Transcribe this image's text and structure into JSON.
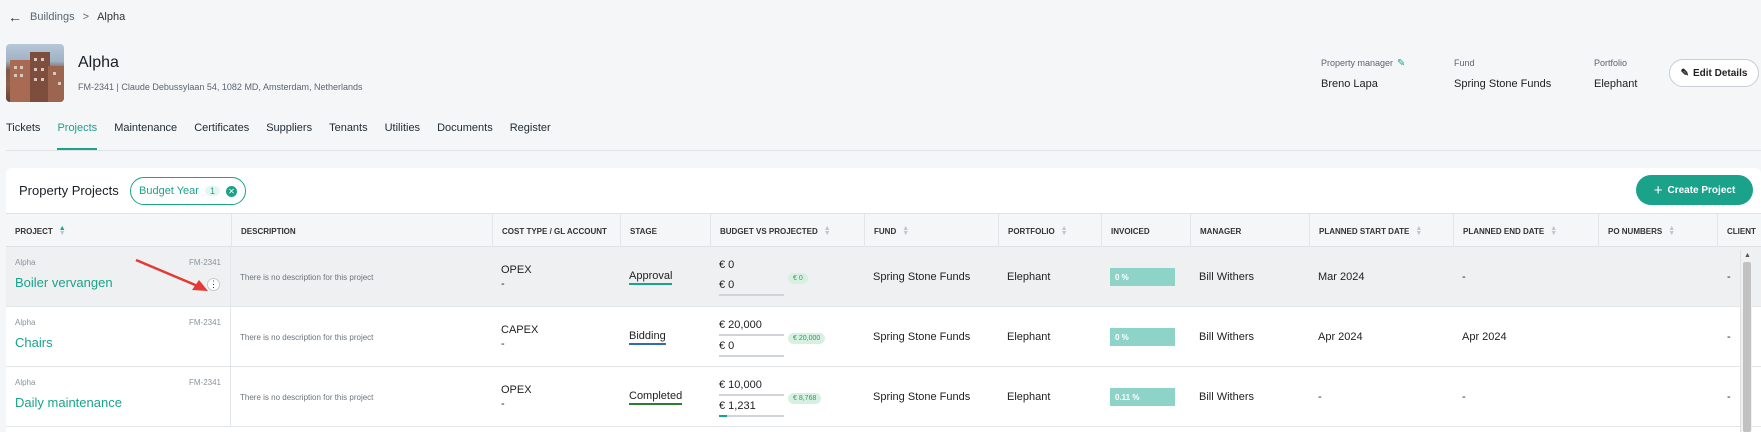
{
  "breadcrumb": {
    "parent": "Buildings",
    "separator": ">",
    "current": "Alpha"
  },
  "property": {
    "name": "Alpha",
    "subtitle": "FM-2341 | Claude Debussylaan 54, 1082 MD, Amsterdam, Netherlands",
    "details": [
      {
        "label": "Property manager",
        "value": "Breno Lapa"
      },
      {
        "label": "Fund",
        "value": "Spring Stone Funds"
      },
      {
        "label": "Portfolio",
        "value": "Elephant"
      }
    ],
    "edit_label": "Edit Details"
  },
  "tabs": [
    {
      "label": "Tickets",
      "active": false
    },
    {
      "label": "Projects",
      "active": true
    },
    {
      "label": "Maintenance",
      "active": false
    },
    {
      "label": "Certificates",
      "active": false
    },
    {
      "label": "Suppliers",
      "active": false
    },
    {
      "label": "Tenants",
      "active": false
    },
    {
      "label": "Utilities",
      "active": false
    },
    {
      "label": "Documents",
      "active": false
    },
    {
      "label": "Register",
      "active": false
    }
  ],
  "panel": {
    "title": "Property Projects",
    "filter_chip": {
      "label": "Budget Year",
      "count": "1"
    },
    "create_label": "Create Project"
  },
  "columns": [
    "Project",
    "Description",
    "Cost Type / GL Account",
    "Stage",
    "Budget vs Projected",
    "Fund",
    "Portfolio",
    "Invoiced",
    "Manager",
    "Planned Start Date",
    "Planned End Date",
    "PO Numbers",
    "Client"
  ],
  "rows": [
    {
      "property": "Alpha",
      "code": "FM-2341",
      "name": "Boiler vervangen",
      "description": "There is no description for this project",
      "cost_type": "OPEX",
      "gl": "-",
      "stage": "Approval",
      "stage_color": "#1aa38a",
      "budget": "€ 0",
      "projected": "€ 0",
      "diff": "€ 0",
      "projected_fraction": 0,
      "fund": "Spring Stone Funds",
      "portfolio": "Elephant",
      "invoiced": "0 %",
      "manager": "Bill Withers",
      "start": "Mar 2024",
      "end": "-",
      "po": "",
      "client": "-"
    },
    {
      "property": "Alpha",
      "code": "FM-2341",
      "name": "Chairs",
      "description": "There is no description for this project",
      "cost_type": "CAPEX",
      "gl": "-",
      "stage": "Bidding",
      "stage_color": "#2f6fb0",
      "budget": "€ 20,000",
      "projected": "€ 0",
      "diff": "€ 20,000",
      "projected_fraction": 0,
      "fund": "Spring Stone Funds",
      "portfolio": "Elephant",
      "invoiced": "0 %",
      "manager": "Bill Withers",
      "start": "Apr 2024",
      "end": "Apr 2024",
      "po": "",
      "client": "-"
    },
    {
      "property": "Alpha",
      "code": "FM-2341",
      "name": "Daily maintenance",
      "description": "There is no description for this project",
      "cost_type": "OPEX",
      "gl": "-",
      "stage": "Completed",
      "stage_color": "#2e7d32",
      "budget": "€ 10,000",
      "projected": "€ 1,231",
      "diff": "€ 8,768",
      "projected_fraction": 0.12,
      "fund": "Spring Stone Funds",
      "portfolio": "Elephant",
      "invoiced": "0.11 %",
      "manager": "Bill Withers",
      "start": "-",
      "end": "-",
      "po": "",
      "client": "-"
    }
  ],
  "colors": {
    "accent": "#1aa38a",
    "annotation_arrow": "#e53935"
  }
}
